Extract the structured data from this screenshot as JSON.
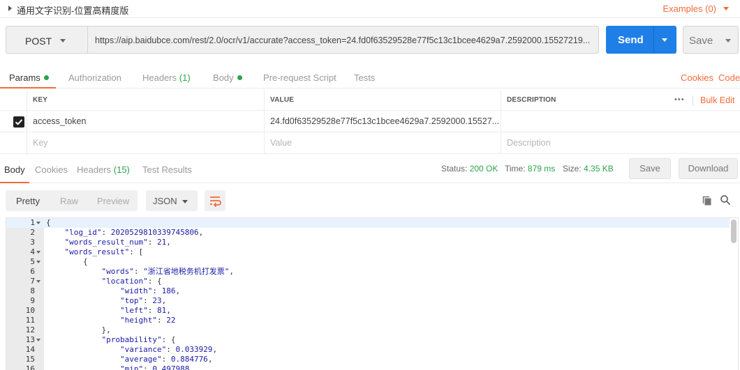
{
  "request": {
    "title": "通用文字识别-位置高精度版",
    "examples_label": "Examples (0)",
    "method": "POST",
    "url": "https://aip.baidubce.com/rest/2.0/ocr/v1/accurate?access_token=24.fd0f63529528e77f5c13c1bcee4629a7.2592000.15527219...",
    "send_label": "Send",
    "save_label": "Save"
  },
  "req_tabs": {
    "params": "Params",
    "authorization": "Authorization",
    "headers": "Headers",
    "headers_count": "(1)",
    "body": "Body",
    "prerequest": "Pre-request Script",
    "tests": "Tests",
    "cookies": "Cookies",
    "code": "Code"
  },
  "params": {
    "headers": {
      "key": "KEY",
      "value": "VALUE",
      "description": "DESCRIPTION"
    },
    "more_label": "•••",
    "bulk_edit": "Bulk Edit",
    "rows": [
      {
        "checked": true,
        "key": "access_token",
        "value": "24.fd0f63529528e77f5c13c1bcee4629a7.2592000.15527...",
        "description": ""
      }
    ],
    "placeholders": {
      "key": "Key",
      "value": "Value",
      "description": "Description"
    }
  },
  "response": {
    "tabs": {
      "body": "Body",
      "cookies": "Cookies",
      "headers": "Headers",
      "headers_count": "(15)",
      "test_results": "Test Results"
    },
    "status_label": "Status:",
    "status_value": "200 OK",
    "time_label": "Time:",
    "time_value": "879 ms",
    "size_label": "Size:",
    "size_value": "4.35 KB",
    "save_label": "Save",
    "download_label": "Download",
    "format": {
      "pretty": "Pretty",
      "raw": "Raw",
      "preview": "Preview",
      "type": "JSON"
    }
  },
  "colors": {
    "accent": "#f26b3a",
    "send": "#1f7fe6",
    "success": "#2ea34a"
  },
  "code_lines": [
    {
      "n": "1",
      "fold": true,
      "text": "{"
    },
    {
      "n": "2",
      "fold": false,
      "text": "    \"log_id\": 2020529810339745806,"
    },
    {
      "n": "3",
      "fold": false,
      "text": "    \"words_result_num\": 21,"
    },
    {
      "n": "4",
      "fold": true,
      "text": "    \"words_result\": ["
    },
    {
      "n": "5",
      "fold": true,
      "text": "        {"
    },
    {
      "n": "6",
      "fold": false,
      "text": "            \"words\": \"浙江省地税务机打发票\","
    },
    {
      "n": "7",
      "fold": true,
      "text": "            \"location\": {"
    },
    {
      "n": "8",
      "fold": false,
      "text": "                \"width\": 186,"
    },
    {
      "n": "9",
      "fold": false,
      "text": "                \"top\": 23,"
    },
    {
      "n": "10",
      "fold": false,
      "text": "                \"left\": 81,"
    },
    {
      "n": "11",
      "fold": false,
      "text": "                \"height\": 22"
    },
    {
      "n": "12",
      "fold": false,
      "text": "            },"
    },
    {
      "n": "13",
      "fold": true,
      "text": "            \"probability\": {"
    },
    {
      "n": "14",
      "fold": false,
      "text": "                \"variance\": 0.033929,"
    },
    {
      "n": "15",
      "fold": false,
      "text": "                \"average\": 0.884776,"
    },
    {
      "n": "16",
      "fold": false,
      "text": "                \"min\": 0.497988"
    }
  ]
}
